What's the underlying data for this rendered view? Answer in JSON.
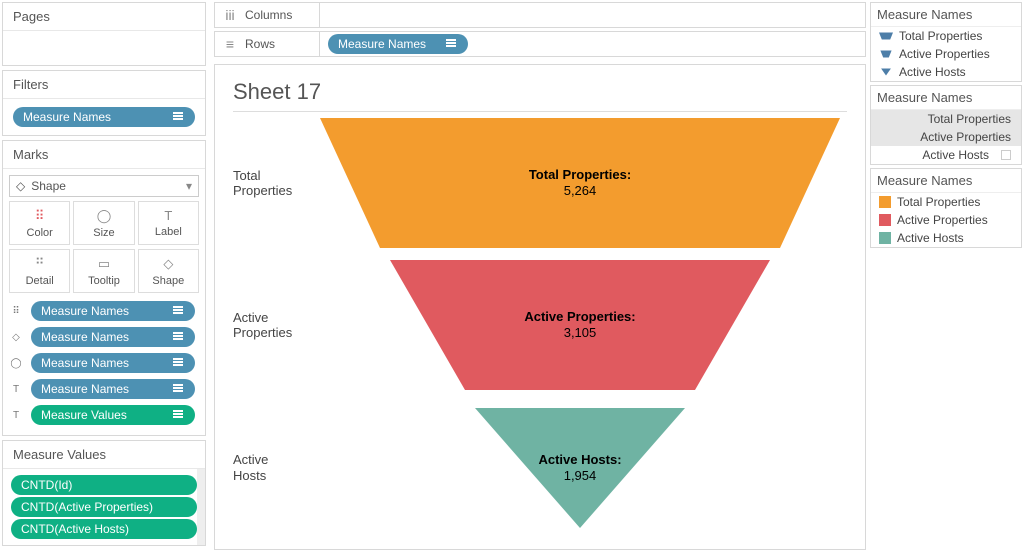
{
  "left": {
    "pages": "Pages",
    "filters": "Filters",
    "filter_pill": "Measure Names",
    "marks": "Marks",
    "marks_type": "Shape",
    "btns1": [
      "Color",
      "Size",
      "Label"
    ],
    "btns2": [
      "Detail",
      "Tooltip",
      "Shape"
    ],
    "encodings": [
      {
        "type": "color",
        "label": "Measure Names"
      },
      {
        "type": "shape",
        "label": "Measure Names"
      },
      {
        "type": "size",
        "label": "Measure Names"
      },
      {
        "type": "text",
        "label": "Measure Names"
      },
      {
        "type": "text",
        "label": "Measure Values",
        "green": true
      }
    ],
    "mv_title": "Measure Values",
    "mv_pills": [
      "CNTD(Id)",
      "CNTD(Active Properties)",
      "CNTD(Active Hosts)"
    ]
  },
  "shelves": {
    "columns": "Columns",
    "rows": "Rows",
    "rows_pill": "Measure Names"
  },
  "sheet": {
    "title": "Sheet 17"
  },
  "chart_data": {
    "type": "funnel",
    "rows": [
      {
        "label": "Total Properties",
        "name": "Total Properties:",
        "value": "5,264",
        "num": 5264,
        "color": "#f39c2e"
      },
      {
        "label": "Active Properties",
        "name": "Active Properties:",
        "value": "3,105",
        "num": 3105,
        "color": "#e05a5f"
      },
      {
        "label": "Active Hosts",
        "name": "Active Hosts:",
        "value": "1,954",
        "num": 1954,
        "color": "#6fb3a3"
      }
    ]
  },
  "legends": {
    "title": "Measure Names",
    "shapes": [
      "Total Properties",
      "Active Properties",
      "Active Hosts"
    ],
    "highlight": [
      "Total Properties",
      "Active Properties",
      "Active Hosts"
    ],
    "colors": [
      {
        "label": "Total Properties",
        "color": "#f39c2e"
      },
      {
        "label": "Active Properties",
        "color": "#e05a5f"
      },
      {
        "label": "Active Hosts",
        "color": "#6fb3a3"
      }
    ]
  }
}
